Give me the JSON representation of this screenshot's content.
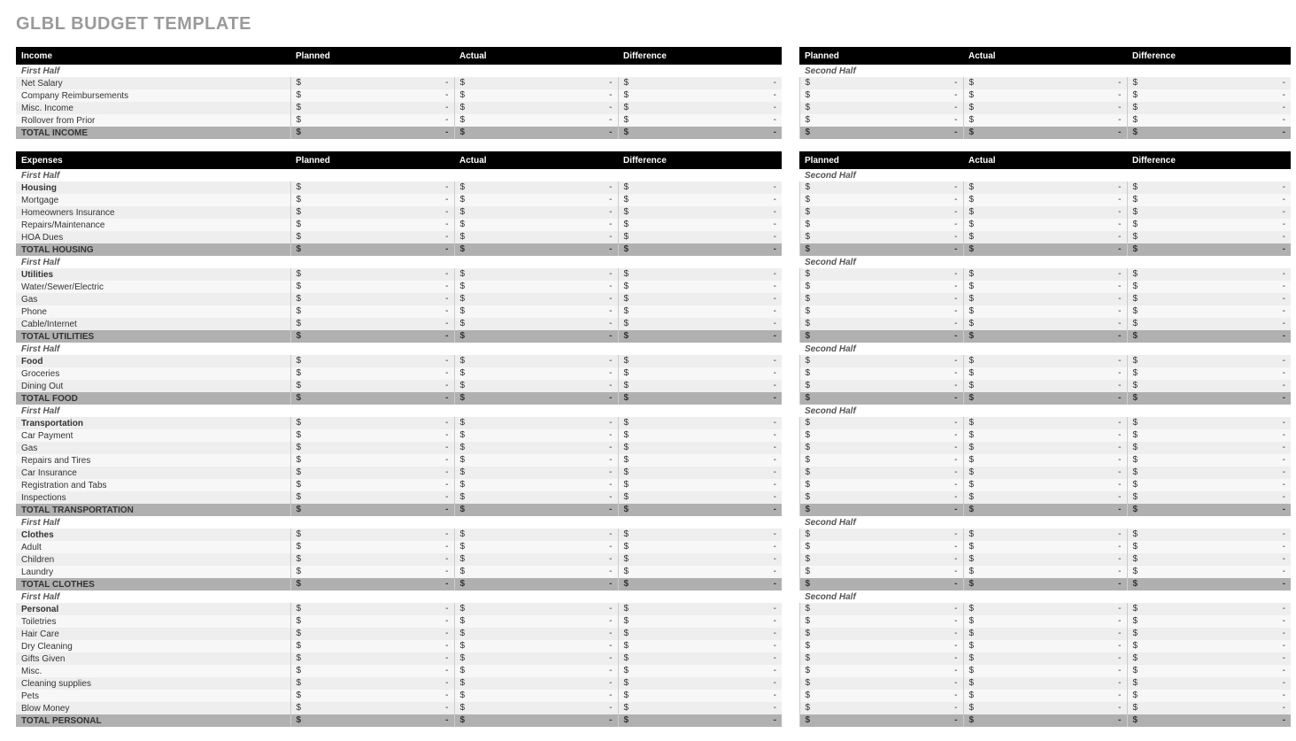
{
  "title": "GLBL BUDGET TEMPLATE",
  "currency": "$",
  "dash": "-",
  "headers": {
    "planned": "Planned",
    "actual": "Actual",
    "difference": "Difference"
  },
  "half_labels": {
    "first": "First Half",
    "second": "Second Half"
  },
  "sections": [
    {
      "title": "Income",
      "groups": [
        {
          "half_header": true,
          "category": null,
          "rows": [
            "Net Salary",
            "Company Reimbursements",
            "Misc. Income",
            "Rollover from Prior"
          ],
          "total": "TOTAL INCOME"
        }
      ]
    },
    {
      "title": "Expenses",
      "groups": [
        {
          "half_header": true,
          "category": "Housing",
          "rows": [
            "Mortgage",
            "Homeowners Insurance",
            "Repairs/Maintenance",
            "HOA Dues"
          ],
          "total": "TOTAL HOUSING"
        },
        {
          "half_header": true,
          "category": "Utilities",
          "rows": [
            "Water/Sewer/Electric",
            "Gas",
            "Phone",
            "Cable/Internet"
          ],
          "total": "TOTAL UTILITIES"
        },
        {
          "half_header": true,
          "category": "Food",
          "rows": [
            "Groceries",
            "Dining Out"
          ],
          "total": "TOTAL FOOD"
        },
        {
          "half_header": true,
          "category": "Transportation",
          "rows": [
            "Car Payment",
            "Gas",
            "Repairs and Tires",
            "Car Insurance",
            "Registration and Tabs",
            "Inspections"
          ],
          "total": "TOTAL TRANSPORTATION"
        },
        {
          "half_header": true,
          "category": "Clothes",
          "rows": [
            "Adult",
            "Children",
            "Laundry"
          ],
          "total": "TOTAL CLOTHES"
        },
        {
          "half_header": true,
          "category": "Personal",
          "rows": [
            "Toiletries",
            "Hair Care",
            "Dry Cleaning",
            "Gifts Given",
            "Misc.",
            "Cleaning supplies",
            "Pets",
            "Blow Money"
          ],
          "total": "TOTAL PERSONAL"
        }
      ]
    }
  ]
}
